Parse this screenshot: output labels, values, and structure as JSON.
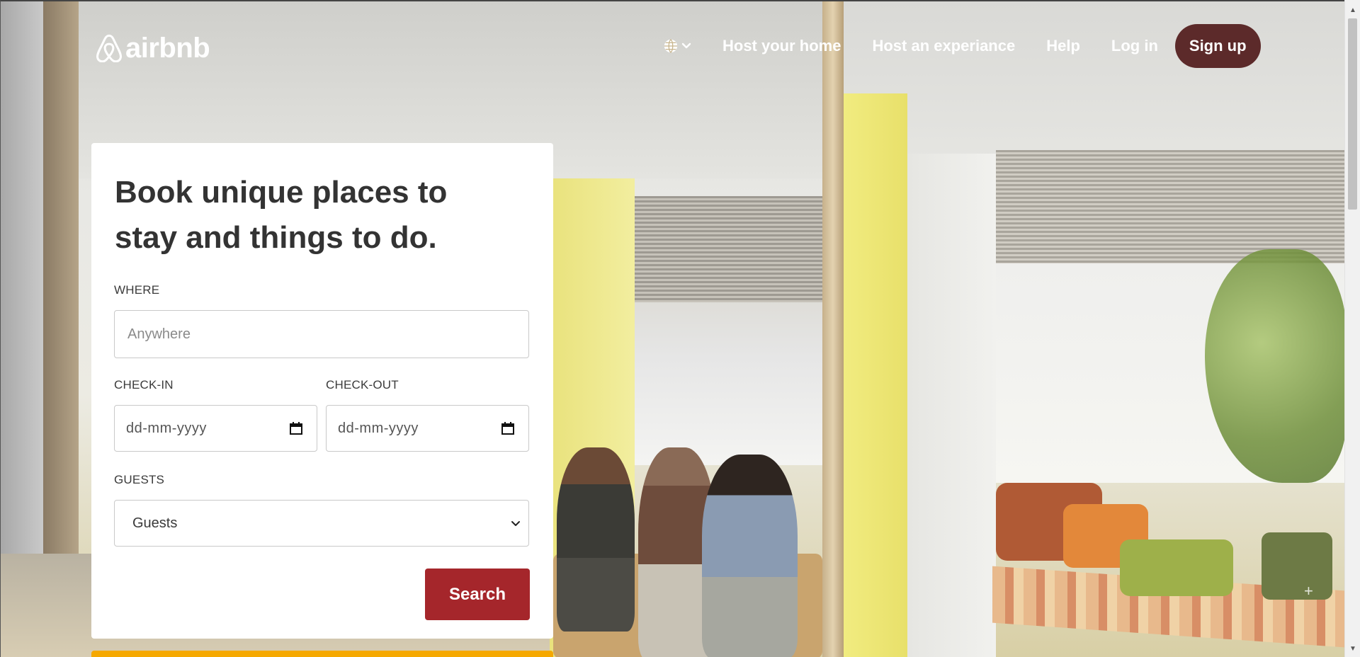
{
  "brand": {
    "name": "airbnb",
    "accent": "#a5262b",
    "signup_bg": "#5c2a2a"
  },
  "nav": {
    "language_icon": "globe-icon",
    "links": [
      {
        "label": "Host your home"
      },
      {
        "label": "Host an experiance"
      },
      {
        "label": "Help"
      },
      {
        "label": "Log in"
      }
    ],
    "signup_label": "Sign up"
  },
  "booking": {
    "title": "Book unique places to stay and things to do.",
    "where": {
      "label": "WHERE",
      "placeholder": "Anywhere"
    },
    "checkin": {
      "label": "CHECK-IN",
      "value": "dd-mm-yyyy"
    },
    "checkout": {
      "label": "CHECK-OUT",
      "value": "dd-mm-yyyy"
    },
    "guests": {
      "label": "GUESTS",
      "value": "Guests"
    },
    "search_label": "Search"
  }
}
